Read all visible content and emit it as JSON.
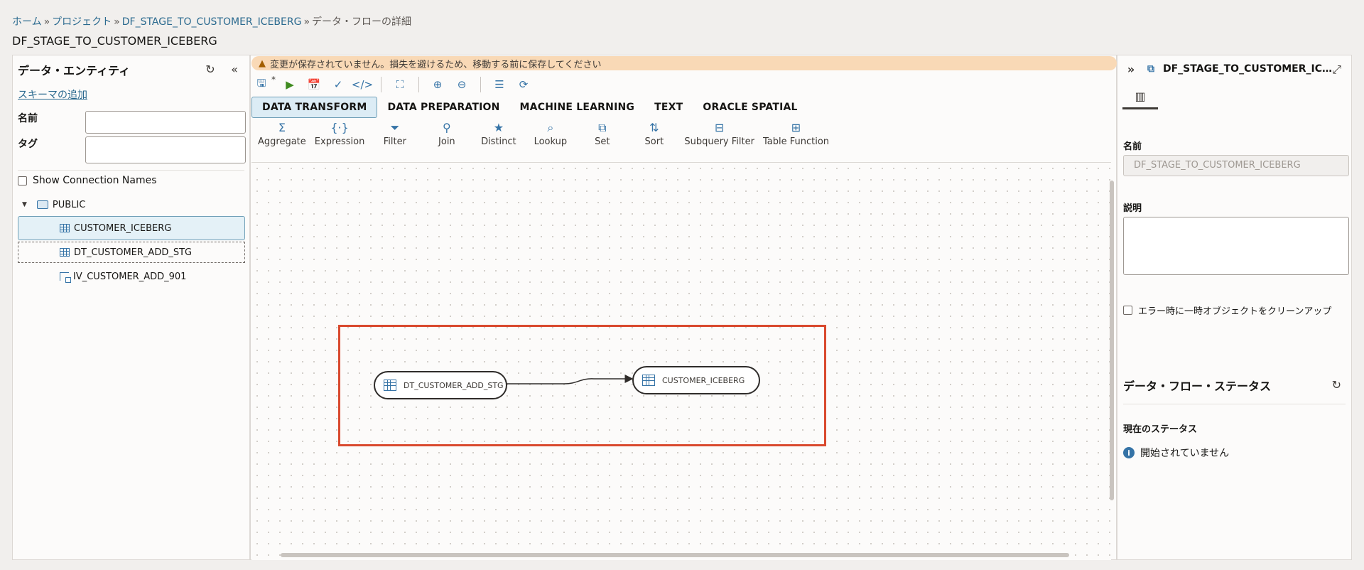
{
  "breadcrumb": {
    "home": "ホーム",
    "project": "プロジェクト",
    "dataflow": "DF_STAGE_TO_CUSTOMER_ICEBERG",
    "current": "データ・フローの詳細",
    "separator": "»"
  },
  "page_title": "DF_STAGE_TO_CUSTOMER_ICEBERG",
  "left_panel": {
    "title": "データ・エンティティ",
    "add_schema_link": "スキーマの追加",
    "name_label": "名前",
    "name_value": "",
    "tag_label": "タグ",
    "tag_value": "",
    "show_connection_names": "Show Connection Names",
    "tree": {
      "schema": "PUBLIC",
      "items": [
        {
          "label": "CUSTOMER_ICEBERG",
          "icon": "table-icon"
        },
        {
          "label": "DT_CUSTOMER_ADD_STG",
          "icon": "table-icon"
        },
        {
          "label": "IV_CUSTOMER_ADD_901",
          "icon": "view-icon"
        }
      ]
    }
  },
  "center": {
    "warning": "変更が保存されていません。損失を避けるため、移動する前に保存してください",
    "unsaved_marker": "*",
    "tabs": [
      "DATA TRANSFORM",
      "DATA PREPARATION",
      "MACHINE LEARNING",
      "TEXT",
      "ORACLE SPATIAL"
    ],
    "active_tab": "DATA TRANSFORM",
    "operators": [
      {
        "label": "Aggregate",
        "icon": "sigma-icon",
        "glyph": "Σ"
      },
      {
        "label": "Expression",
        "icon": "expression-icon",
        "glyph": "{·}"
      },
      {
        "label": "Filter",
        "icon": "filter-icon",
        "glyph": "⏷"
      },
      {
        "label": "Join",
        "icon": "join-icon",
        "glyph": "⚲"
      },
      {
        "label": "Distinct",
        "icon": "star-icon",
        "glyph": "★"
      },
      {
        "label": "Lookup",
        "icon": "lookup-icon",
        "glyph": "⌕"
      },
      {
        "label": "Set",
        "icon": "set-icon",
        "glyph": "⧉"
      },
      {
        "label": "Sort",
        "icon": "sort-icon",
        "glyph": "⇅"
      },
      {
        "label": "Subquery Filter",
        "icon": "subquery-filter-icon",
        "glyph": "⊟"
      },
      {
        "label": "Table Function",
        "icon": "table-function-icon",
        "glyph": "⊞"
      }
    ],
    "nodes": {
      "source": "DT_CUSTOMER_ADD_STG",
      "target": "CUSTOMER_ICEBERG"
    }
  },
  "right_panel": {
    "title": "DF_STAGE_TO_CUSTOMER_IC…",
    "name_label": "名前",
    "name_value": "DF_STAGE_TO_CUSTOMER_ICEBERG",
    "description_label": "説明",
    "description_value": "",
    "cleanup_checkbox": "エラー時に一時オブジェクトをクリーンアップ",
    "status_section": "データ・フロー・ステータス",
    "current_status_label": "現在のステータス",
    "current_status_value": "開始されていません"
  },
  "colors": {
    "link": "#2b6a8f",
    "accent": "#3573a6",
    "warning_bg": "#f9d9b6",
    "highlight": "#d9492e",
    "run": "#3f8b1f"
  }
}
